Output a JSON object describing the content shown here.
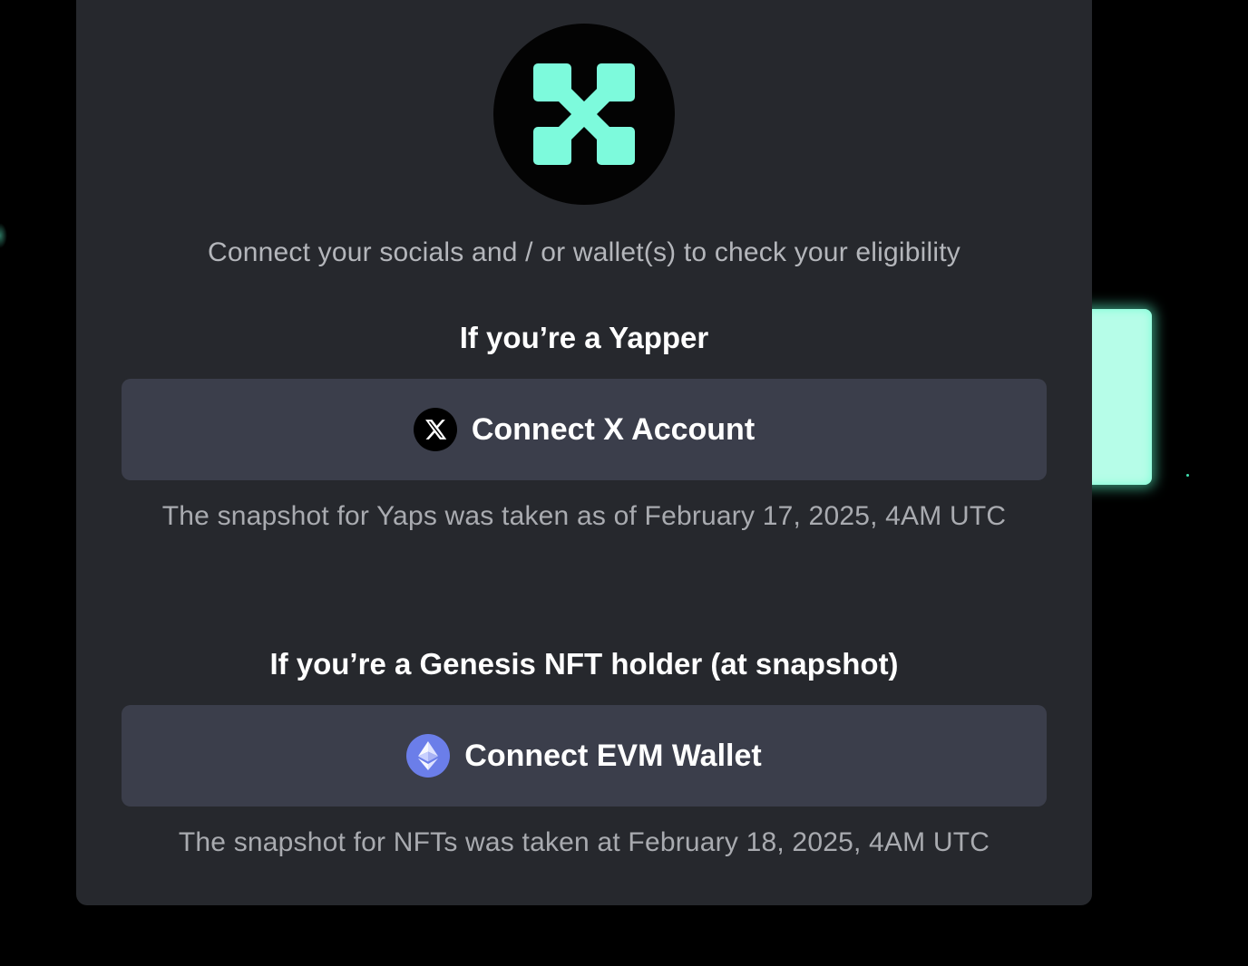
{
  "modal": {
    "logo_icon": "x-cross-logo-icon",
    "subtitle": "Connect your socials and / or wallet(s) to check your eligibility",
    "yapper_section": {
      "heading": "If you’re a Yapper",
      "button_label": "Connect X Account",
      "button_icon": "x-icon",
      "note": "The snapshot for Yaps was taken as of February 17, 2025, 4AM UTC"
    },
    "nft_section": {
      "heading": "If you’re a Genesis NFT holder (at snapshot)",
      "button_label": "Connect EVM Wallet",
      "button_icon": "ethereum-icon",
      "note": "The snapshot for NFTs was taken at February 18, 2025, 4AM UTC"
    }
  },
  "colors": {
    "background": "#000000",
    "modal": "#26282d",
    "button": "#3b3e4b",
    "accent": "#7dfadc",
    "ethereum": "#6b7ee9"
  }
}
